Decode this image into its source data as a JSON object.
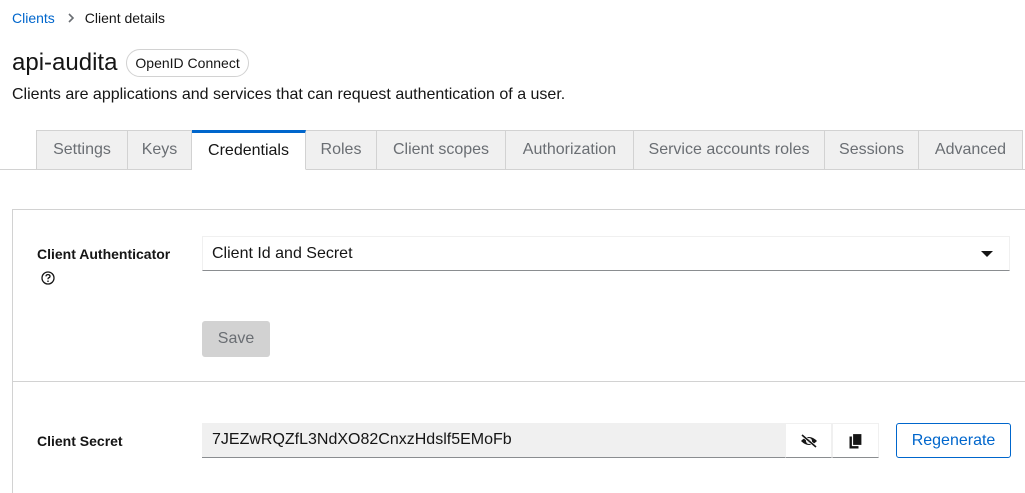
{
  "breadcrumb": {
    "parent": "Clients",
    "current": "Client details"
  },
  "header": {
    "title": "api-audita",
    "badge": "OpenID Connect",
    "subtitle": "Clients are applications and services that can request authentication of a user."
  },
  "tabs": [
    {
      "label": "Settings",
      "active": false
    },
    {
      "label": "Keys",
      "active": false
    },
    {
      "label": "Credentials",
      "active": true
    },
    {
      "label": "Roles",
      "active": false
    },
    {
      "label": "Client scopes",
      "active": false
    },
    {
      "label": "Authorization",
      "active": false
    },
    {
      "label": "Service accounts roles",
      "active": false
    },
    {
      "label": "Sessions",
      "active": false
    },
    {
      "label": "Advanced",
      "active": false
    }
  ],
  "authenticator": {
    "label": "Client Authenticator",
    "value": "Client Id and Secret",
    "save_label": "Save"
  },
  "secret": {
    "label": "Client Secret",
    "value": "7JEZwRQZfL3NdXO82CnxzHdslf5EMoFb",
    "regenerate_label": "Regenerate"
  },
  "icons": {
    "breadcrumb_separator": "chevron-right-icon",
    "help": "help-icon",
    "dropdown": "caret-down-icon",
    "visibility": "eye-slash-icon",
    "copy": "copy-icon"
  },
  "colors": {
    "accent": "#0066cc",
    "text": "#151515",
    "muted": "#6a6e73",
    "border": "#d2d2d2",
    "tab_bg": "#f0f0f0"
  }
}
